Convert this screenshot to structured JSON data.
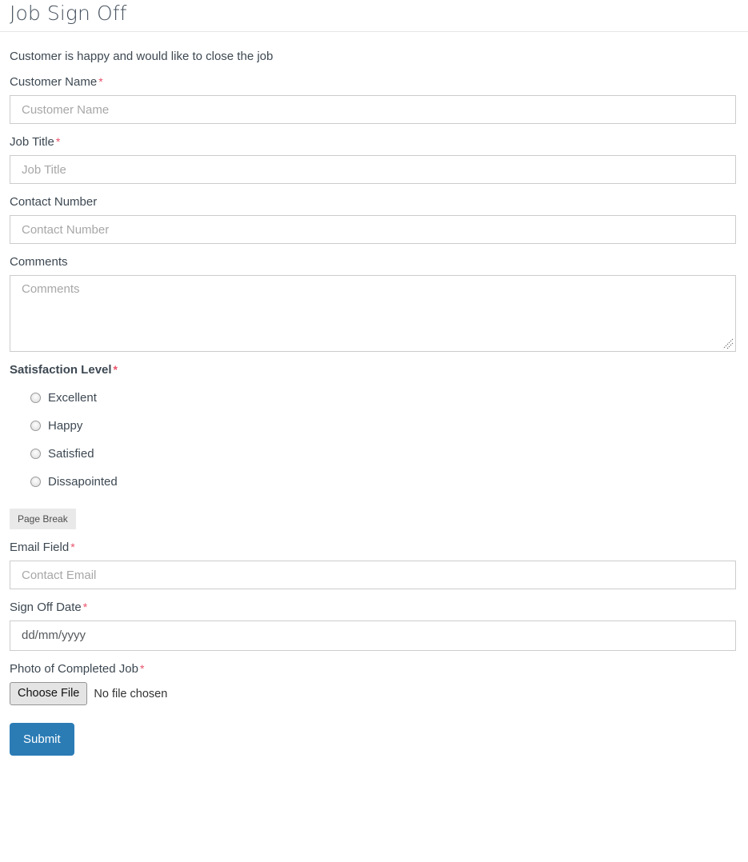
{
  "header": {
    "title": "Job Sign Off"
  },
  "intro": {
    "text": "Customer is happy and would like to close the job"
  },
  "fields": {
    "customer_name": {
      "label": "Customer Name",
      "required_mark": "*",
      "placeholder": "Customer Name",
      "value": ""
    },
    "job_title": {
      "label": "Job Title",
      "required_mark": "*",
      "placeholder": "Job Title",
      "value": ""
    },
    "contact_number": {
      "label": "Contact Number",
      "placeholder": "Contact Number",
      "value": ""
    },
    "comments": {
      "label": "Comments",
      "placeholder": "Comments",
      "value": ""
    },
    "satisfaction": {
      "label": "Satisfaction Level",
      "required_mark": "*",
      "options": [
        {
          "label": "Excellent",
          "selected": false
        },
        {
          "label": "Happy",
          "selected": false
        },
        {
          "label": "Satisfied",
          "selected": false
        },
        {
          "label": "Dissapointed",
          "selected": false
        }
      ]
    },
    "page_break": {
      "label": "Page Break"
    },
    "email": {
      "label": "Email Field",
      "required_mark": "*",
      "placeholder": "Contact Email",
      "value": ""
    },
    "sign_off_date": {
      "label": "Sign Off Date",
      "required_mark": "*",
      "display_value": "dd/mm/yyyy"
    },
    "photo": {
      "label": "Photo of Completed Job",
      "required_mark": "*",
      "button_label": "Choose File",
      "status_text": "No file chosen"
    }
  },
  "actions": {
    "submit_label": "Submit"
  },
  "colors": {
    "accent": "#2b7cb5",
    "required": "#e8536b",
    "text": "#3d4852",
    "border": "#cccccc",
    "page_break_bg": "#e9e9e9"
  }
}
